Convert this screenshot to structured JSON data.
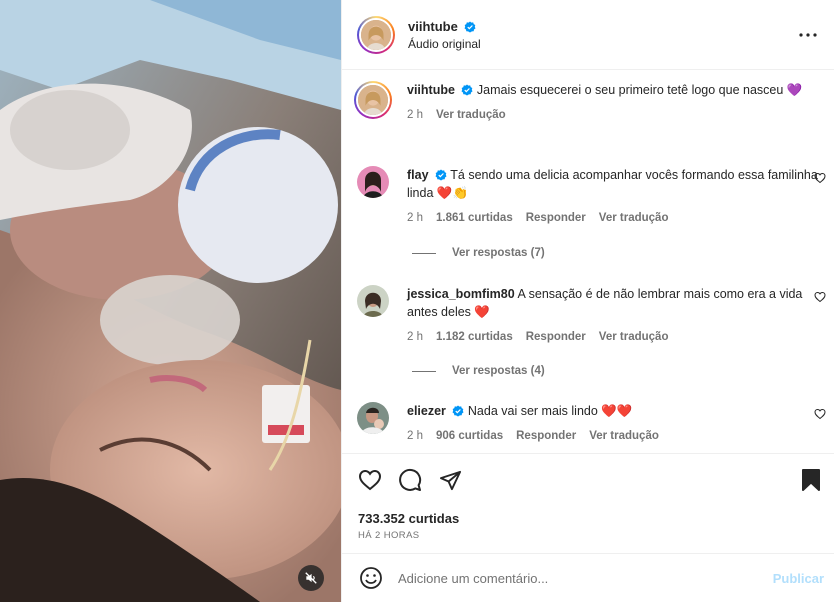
{
  "header": {
    "username": "viihtube",
    "subtitle": "Áudio original"
  },
  "caption": {
    "username": "viihtube",
    "text": "Jamais esquecerei o seu primeiro tetê logo que nasceu",
    "emoji": "💜",
    "time": "2 h",
    "translate": "Ver tradução"
  },
  "comments": [
    {
      "username": "flay",
      "verified": true,
      "text": "Tá sendo uma delicia acompanhar vocês formando essa familinha linda",
      "emoji": "❤️👏",
      "time": "2 h",
      "likes": "1.861 curtidas",
      "reply": "Responder",
      "translate": "Ver tradução",
      "view_replies": "Ver respostas (7)"
    },
    {
      "username": "jessica_bomfim80",
      "verified": false,
      "text": "A sensação é de não lembrar mais como era a vida antes deles",
      "emoji": "❤️",
      "time": "2 h",
      "likes": "1.182 curtidas",
      "reply": "Responder",
      "translate": "Ver tradução",
      "view_replies": "Ver respostas (4)"
    },
    {
      "username": "eliezer",
      "verified": true,
      "text": "Nada vai ser mais lindo",
      "emoji": "❤️❤️",
      "time": "2 h",
      "likes": "906 curtidas",
      "reply": "Responder",
      "translate": "Ver tradução"
    }
  ],
  "stats": {
    "likes": "733.352 curtidas",
    "ago": "HÁ 2 HORAS"
  },
  "add_comment": {
    "placeholder": "Adicione um comentário...",
    "publish": "Publicar"
  },
  "colors": {
    "verified": "#0095f6",
    "muted_text": "#737373",
    "publish_disabled": "#b2dffc",
    "heart": "#ed4956"
  },
  "icons": [
    "more-icon",
    "heart-icon",
    "comment-icon",
    "share-icon",
    "bookmark-icon",
    "emoji-icon",
    "mute-icon",
    "verified-icon"
  ]
}
